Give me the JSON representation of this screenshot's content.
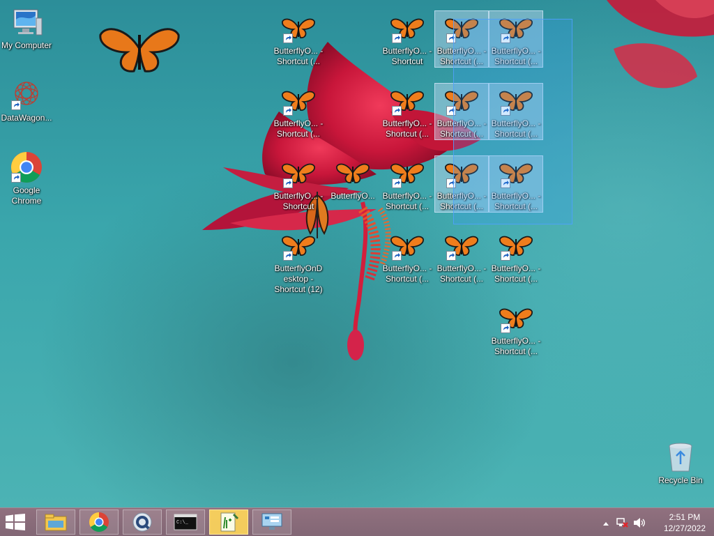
{
  "desktop": {
    "icons": [
      {
        "label": "My Computer",
        "type": "computer"
      },
      {
        "label": "DataWagon...",
        "type": "datawagon",
        "shortcut": true
      },
      {
        "label": "Google Chrome",
        "type": "chrome",
        "shortcut": true
      },
      {
        "label": "ButterflyO... - Shortcut (...",
        "type": "butterfly",
        "shortcut": true
      },
      {
        "label": "ButterflyO... - Shortcut",
        "type": "butterfly",
        "shortcut": true
      },
      {
        "label": "ButterflyO... - Shortcut (...",
        "type": "butterfly",
        "shortcut": true,
        "selected": true
      },
      {
        "label": "ButterflyO... - Shortcut (...",
        "type": "butterfly",
        "shortcut": true,
        "selected": true
      },
      {
        "label": "ButterflyO... - Shortcut (...",
        "type": "butterfly",
        "shortcut": true
      },
      {
        "label": "ButterflyO... - Shortcut (...",
        "type": "butterfly",
        "shortcut": true
      },
      {
        "label": "ButterflyO... - Shortcut (...",
        "type": "butterfly",
        "shortcut": true,
        "selected": true
      },
      {
        "label": "ButterflyO... - Shortcut (...",
        "type": "butterfly",
        "shortcut": true,
        "selected": true
      },
      {
        "label": "ButterflyO... - Shortcut",
        "type": "butterfly",
        "shortcut": true
      },
      {
        "label": "ButterflyO...",
        "type": "butterfly",
        "shortcut": false
      },
      {
        "label": "ButterflyO... - Shortcut (...",
        "type": "butterfly",
        "shortcut": true
      },
      {
        "label": "ButterflyO... - Shortcut (...",
        "type": "butterfly",
        "shortcut": true,
        "selected": true
      },
      {
        "label": "ButterflyO... - Shortcut (...",
        "type": "butterfly",
        "shortcut": true,
        "selected": true
      },
      {
        "label": "ButterflyOnD esktop - Shortcut (12)",
        "type": "butterfly",
        "shortcut": true
      },
      {
        "label": "ButterflyO... - Shortcut (...",
        "type": "butterfly",
        "shortcut": true
      },
      {
        "label": "ButterflyO... - Shortcut (...",
        "type": "butterfly",
        "shortcut": true
      },
      {
        "label": "ButterflyO... - Shortcut (...",
        "type": "butterfly",
        "shortcut": true
      },
      {
        "label": "ButterflyO... - Shortcut (...",
        "type": "butterfly",
        "shortcut": true
      },
      {
        "label": "Recycle Bin",
        "type": "recycle"
      }
    ]
  },
  "taskbar": {
    "buttons": [
      {
        "name": "file-explorer",
        "active": false
      },
      {
        "name": "chrome",
        "active": false
      },
      {
        "name": "quicktime",
        "active": false
      },
      {
        "name": "command-prompt",
        "active": false
      },
      {
        "name": "notepad-plus",
        "active": true
      },
      {
        "name": "control-panel",
        "active": false
      }
    ]
  },
  "tray": {
    "time": "2:51 PM",
    "date": "12/27/2022"
  },
  "colors": {
    "desktop_teal": "#2f9aa3",
    "flower_red": "#d0213e",
    "taskbar": "#8d6877",
    "selection": "#3399ff"
  }
}
